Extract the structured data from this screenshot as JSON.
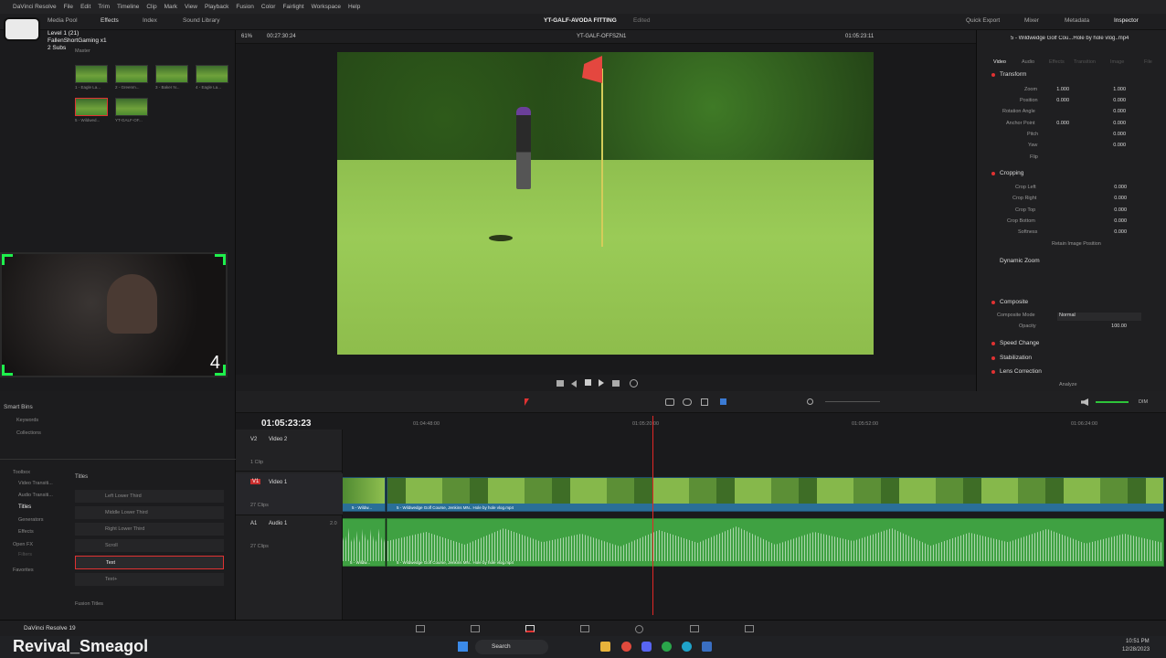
{
  "menu": {
    "app": "DaVinci Resolve",
    "items": [
      "File",
      "Edit",
      "Trim",
      "Timeline",
      "Clip",
      "Mark",
      "View",
      "Playback",
      "Fusion",
      "Color",
      "Fairlight",
      "Workspace",
      "Help"
    ]
  },
  "toolbar": {
    "media_pool": "Media Pool",
    "effects": "Effects",
    "index": "Index",
    "sound_library": "Sound Library",
    "project_title": "YT-GALF-AVODA FITTING",
    "edited": "Edited",
    "quick_export": "Quick Export",
    "mixer": "Mixer",
    "metadata": "Metadata",
    "inspector": "Inspector"
  },
  "overlay": {
    "level": "Level 1 (21)",
    "channel": "FallenShortGaming x1",
    "subs": "2 Subs",
    "counter": "4",
    "streamer": "Revival_Smeagol"
  },
  "mediapool": {
    "master": "Master",
    "clips": [
      "1 - Eagle La...",
      "2 - Greenm...",
      "3 - Baker N...",
      "4 - Eagle La...",
      "5 - Wildwed...",
      "YT-GALF-OF..."
    ]
  },
  "viewer": {
    "zoom": "61%",
    "src_tc": "00:27:30:24",
    "timeline_name": "YT-GALF-OFFSZN1",
    "rec_tc": "01:05:23:11"
  },
  "inspector": {
    "clip_name": "5 - Wildwedge Golf Cou...Hole by hole vlog..mp4",
    "tabs": [
      "Video",
      "Audio",
      "Effects",
      "Transition",
      "Image",
      "File"
    ],
    "transform": {
      "title": "Transform",
      "rows": [
        {
          "label": "Zoom",
          "x": "1.000",
          "y": "1.000"
        },
        {
          "label": "Position",
          "x": "0.000",
          "y": "0.000"
        },
        {
          "label": "Rotation Angle",
          "x": "",
          "y": "0.000"
        },
        {
          "label": "Anchor Point",
          "x": "0.000",
          "y": "0.000"
        },
        {
          "label": "Pitch",
          "x": "",
          "y": "0.000"
        },
        {
          "label": "Yaw",
          "x": "",
          "y": "0.000"
        },
        {
          "label": "Flip",
          "x": "",
          "y": ""
        }
      ]
    },
    "cropping": {
      "title": "Cropping",
      "rows": [
        {
          "label": "Crop Left",
          "value": "0.000"
        },
        {
          "label": "Crop Right",
          "value": "0.000"
        },
        {
          "label": "Crop Top",
          "value": "0.000"
        },
        {
          "label": "Crop Bottom",
          "value": "0.000"
        },
        {
          "label": "Softness",
          "value": "0.000"
        }
      ],
      "retain": "Retain Image Position"
    },
    "dynamic_zoom": "Dynamic Zoom",
    "composite": {
      "title": "Composite",
      "mode_label": "Composite Mode",
      "mode": "Normal",
      "opacity_label": "Opacity",
      "opacity": "100.00"
    },
    "speed_change": "Speed Change",
    "stabilization": "Stabilization",
    "lens_correction": "Lens Correction",
    "analyze": "Analyze"
  },
  "effects": {
    "smart_bins": "Smart Bins",
    "keywords": "Keywords",
    "collections": "Collections",
    "toolbox": [
      "Toolbox",
      "Video Transiti...",
      "Audio Transiti...",
      "Titles",
      "Generators",
      "Effects",
      "Open FX",
      "Filters",
      "Favorites"
    ],
    "titles_header": "Titles",
    "titles": [
      "Left Lower Third",
      "Middle Lower Third",
      "Right Lower Third",
      "Scroll",
      "Text",
      "Text+"
    ],
    "fusion_titles": "Fusion Titles"
  },
  "timeline": {
    "timecode": "01:05:23:23",
    "ruler": [
      "01:04:48:00",
      "01:05:20:00",
      "01:05:52:00",
      "01:06:24:00"
    ],
    "tracks": [
      {
        "id": "V2",
        "name": "Video 2",
        "clips": "1 Clip"
      },
      {
        "id": "V1",
        "name": "Video 1",
        "clips": "27 Clips"
      },
      {
        "id": "A1",
        "name": "Audio 1",
        "clips": "27 Clips",
        "level": "2.0"
      }
    ],
    "video_clip_label": "5 - Wildwedge Golf Course, Jenkins MN.. Hole by hole vlog.mp4",
    "audio_clip_label": "5 - Wildwedge Golf Course, Jenkins MN.. Hole by hole vlog.mp4",
    "left_clip_label": "5 - Wildw...",
    "dim": "DIM"
  },
  "footer": {
    "app_version": "DaVinci Resolve 19"
  },
  "taskbar": {
    "search": "Search",
    "time": "10:51 PM",
    "date": "12/28/2023"
  },
  "colors": {
    "accent_red": "#e03232",
    "video_clip": "#2a6f98",
    "audio_clip": "#3fa142",
    "overlay_green": "#1ef04c"
  }
}
